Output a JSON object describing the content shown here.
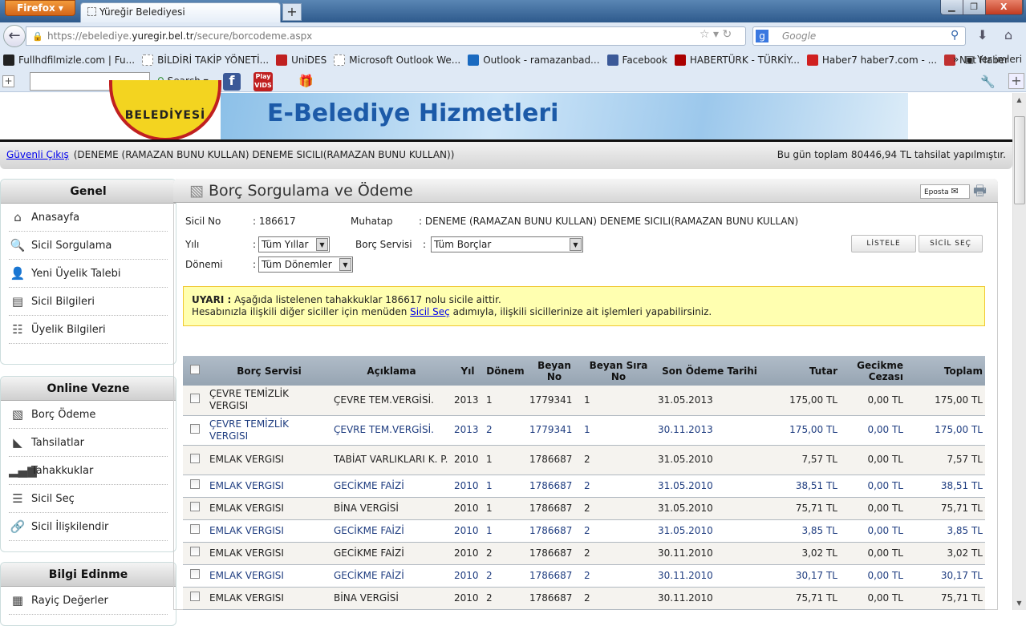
{
  "browser": {
    "menu_label": "Firefox ▾",
    "tab_title": "Yüreğir Belediyesi",
    "url_pre": "https://ebelediye.",
    "url_host": "yuregir.bel.tr",
    "url_post": "/secure/borcodeme.aspx",
    "search_placeholder": "Google",
    "toolbar_search": "Search",
    "bookmarks": [
      {
        "label": "Fullhdfilmizle.com | Fu...",
        "color": "#222"
      },
      {
        "label": "BİLDİRİ TAKİP YÖNETİ...",
        "color": "#fff"
      },
      {
        "label": "UniDES",
        "color": "#c02020"
      },
      {
        "label": "Microsoft Outlook We...",
        "color": "#fff"
      },
      {
        "label": "Outlook - ramazanbad...",
        "color": "#1a6ac0"
      },
      {
        "label": "Facebook",
        "color": "#3b5998"
      },
      {
        "label": "HABERTÜRK - TÜRKİY...",
        "color": "#a00"
      },
      {
        "label": "Haber7 haber7.com - ...",
        "color": "#d02020"
      },
      {
        "label": "Net Haber",
        "color": "#c03030"
      }
    ],
    "bookmarks_more": "»",
    "bookmarks_menu": "Yer imleri"
  },
  "header": {
    "title": "E-Belediye Hizmetleri",
    "logo_text": "BELEDİYESİ"
  },
  "userbar": {
    "logout": "Güvenli Çıkış",
    "user": "(DENEME (RAMAZAN BUNU KULLAN) DENEME SICILI(RAMAZAN BUNU KULLAN))",
    "daily": "Bu gün toplam 80446,94 TL tahsilat yapılmıştır."
  },
  "sidebar": {
    "genel": {
      "title": "Genel",
      "items": [
        {
          "label": "Anasayfa",
          "icon": "⌂"
        },
        {
          "label": "Sicil Sorgulama",
          "icon": "🔍"
        },
        {
          "label": "Yeni Üyelik Talebi",
          "icon": "👤"
        },
        {
          "label": "Sicil Bilgileri",
          "icon": "▤"
        },
        {
          "label": "Üyelik Bilgileri",
          "icon": "☷"
        }
      ]
    },
    "vezne": {
      "title": "Online Vezne",
      "items": [
        {
          "label": "Borç Ödeme",
          "icon": "▧"
        },
        {
          "label": "Tahsilatlar",
          "icon": "◣"
        },
        {
          "label": "Tahakkuklar",
          "icon": "▂▄▆"
        },
        {
          "label": "Sicil Seç",
          "icon": "☰"
        },
        {
          "label": "Sicil İlişkilendir",
          "icon": "🔗"
        }
      ]
    },
    "bilgi": {
      "title": "Bilgi Edinme",
      "items": [
        {
          "label": "Rayiç Değerler",
          "icon": "▦"
        }
      ]
    }
  },
  "main": {
    "title": "Borç Sorgulama ve Ödeme",
    "eposta": "Eposta",
    "sicil_label": "Sicil No",
    "sicil_value": ": 186617",
    "muhatap_label": "Muhatap",
    "muhatap_value": ": DENEME (RAMAZAN BUNU KULLAN) DENEME SICILI(RAMAZAN BUNU KULLAN)",
    "yil_label": "Yılı",
    "yil_value": "Tüm Yıllar",
    "servis_label": "Borç Servisi",
    "servis_value": "Tüm Borçlar",
    "donem_label": "Dönemi",
    "donem_value": "Tüm Dönemler",
    "colon": ":",
    "listele": "LİSTELE",
    "sicil_sec": "SİCİL SEÇ",
    "warning": {
      "bold": "UYARI :",
      "line1": " Aşağıda listelenen tahakkuklar 186617  nolu sicile aittir.",
      "line2_pre": "Hesabınızla ilişkili diğer siciller için menüden ",
      "link": "Sicil Seç",
      "line2_post": "  adımıyla, ilişkili sicillerinize ait işlemleri yapabilirsiniz."
    },
    "columns": [
      "Borç Servisi",
      "Açıklama",
      "Yıl",
      "Dönem",
      "Beyan No",
      "Beyan Sıra No",
      "Son Ödeme Tarihi",
      "Tutar",
      "Gecikme Cezası",
      "Toplam"
    ],
    "rows": [
      [
        "ÇEVRE TEMİZLİK VERGISI",
        "ÇEVRE TEM.VERGİSİ.",
        "2013",
        "1",
        "1779341",
        "1",
        "31.05.2013",
        "175,00 TL",
        "0,00 TL",
        "175,00 TL"
      ],
      [
        "ÇEVRE TEMİZLİK VERGISI",
        "ÇEVRE TEM.VERGİSİ.",
        "2013",
        "2",
        "1779341",
        "1",
        "30.11.2013",
        "175,00 TL",
        "0,00 TL",
        "175,00 TL"
      ],
      [
        "EMLAK VERGISI",
        "TABİAT VARLIKLARI K. P.",
        "2010",
        "1",
        "1786687",
        "2",
        "31.05.2010",
        "7,57 TL",
        "0,00 TL",
        "7,57 TL"
      ],
      [
        "EMLAK VERGISI",
        "GECİKME FAİZİ",
        "2010",
        "1",
        "1786687",
        "2",
        "31.05.2010",
        "38,51 TL",
        "0,00 TL",
        "38,51 TL"
      ],
      [
        "EMLAK VERGISI",
        "BİNA VERGİSİ",
        "2010",
        "1",
        "1786687",
        "2",
        "31.05.2010",
        "75,71 TL",
        "0,00 TL",
        "75,71 TL"
      ],
      [
        "EMLAK VERGISI",
        "GECİKME FAİZİ",
        "2010",
        "1",
        "1786687",
        "2",
        "31.05.2010",
        "3,85 TL",
        "0,00 TL",
        "3,85 TL"
      ],
      [
        "EMLAK VERGISI",
        "GECİKME FAİZİ",
        "2010",
        "2",
        "1786687",
        "2",
        "30.11.2010",
        "3,02 TL",
        "0,00 TL",
        "3,02 TL"
      ],
      [
        "EMLAK VERGISI",
        "GECİKME FAİZİ",
        "2010",
        "2",
        "1786687",
        "2",
        "30.11.2010",
        "30,17 TL",
        "0,00 TL",
        "30,17 TL"
      ],
      [
        "EMLAK VERGISI",
        "BİNA VERGİSİ",
        "2010",
        "2",
        "1786687",
        "2",
        "30.11.2010",
        "75,71 TL",
        "0,00 TL",
        "75,71 TL"
      ]
    ]
  }
}
